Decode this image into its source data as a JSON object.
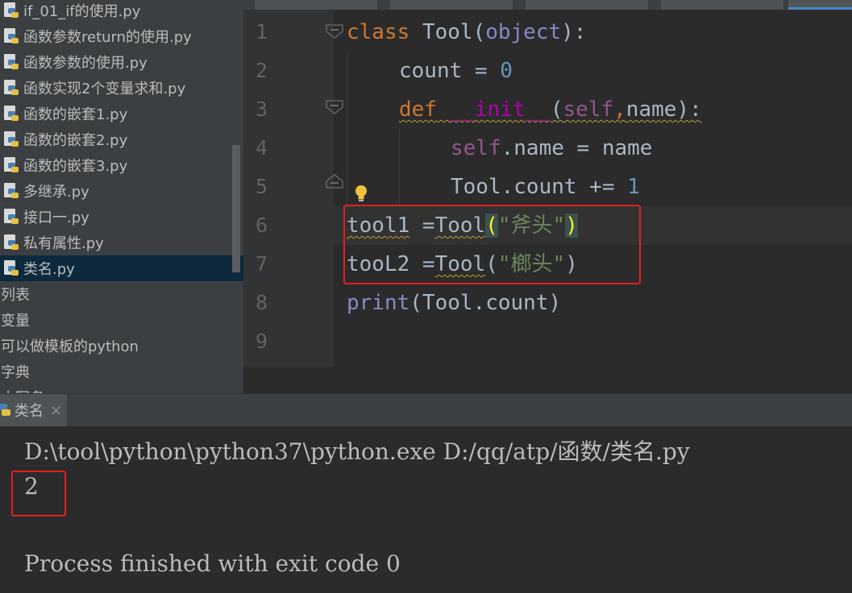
{
  "project_tree": {
    "items": [
      {
        "label": "if_01_if的使用.py",
        "type": "python-file"
      },
      {
        "label": "函数参数return的使用.py",
        "type": "python-file"
      },
      {
        "label": "函数参数的使用.py",
        "type": "python-file"
      },
      {
        "label": "函数实现2个变量求和.py",
        "type": "python-file"
      },
      {
        "label": "函数的嵌套1.py",
        "type": "python-file"
      },
      {
        "label": "函数的嵌套2.py",
        "type": "python-file"
      },
      {
        "label": "函数的嵌套3.py",
        "type": "python-file"
      },
      {
        "label": "多继承.py",
        "type": "python-file"
      },
      {
        "label": "接口一.py",
        "type": "python-file"
      },
      {
        "label": "私有属性.py",
        "type": "python-file"
      },
      {
        "label": "类名.py",
        "type": "python-file",
        "selected": true
      },
      {
        "label": "列表",
        "type": "folder"
      },
      {
        "label": "变量",
        "type": "folder"
      },
      {
        "label": "可以做模板的python",
        "type": "folder"
      },
      {
        "label": "字典",
        "type": "folder"
      },
      {
        "label": "小写名",
        "type": "folder"
      }
    ]
  },
  "editor": {
    "line_numbers": [
      "1",
      "2",
      "3",
      "4",
      "5",
      "6",
      "7",
      "8",
      "9"
    ],
    "code": {
      "l1": {
        "kw": "class",
        "name": "Tool",
        "p1": "(",
        "base": "object",
        "p2": "):"
      },
      "l2": {
        "var": "count",
        "op": " = ",
        "num": "0"
      },
      "l3": {
        "kw": "def",
        "sp": " ",
        "name": "__init__",
        "p1": "(",
        "self": "self",
        "comma": ",",
        "arg": "name",
        "p2": "):"
      },
      "l4": {
        "self": "self",
        "rest": ".name = name"
      },
      "l5": {
        "lhs": "Tool.count += ",
        "num": "1"
      },
      "l6": {
        "var": "tool1",
        "op": " =",
        "call": "Tool",
        "p1": "(",
        "str": "\"斧头\"",
        "p2": ")"
      },
      "l7": {
        "var": "tooL2",
        "op": " =",
        "call": "Tool",
        "p1": "(",
        "str": "\"榔头\"",
        "p2": ")"
      },
      "l8": {
        "fn": "print",
        "arg": "(Tool.count)"
      }
    },
    "colors": {
      "keyword": "#cc7832",
      "builtin": "#8888c6",
      "number": "#6897bb",
      "self": "#94558d",
      "string": "#6a8759",
      "magic": "#b200b2",
      "highlight_box": "#e0201e"
    }
  },
  "run_panel": {
    "tab_label": "类名",
    "close_glyph": "×",
    "console_lines": [
      "D:\\tool\\python\\python37\\python.exe D:/qq/atp/函数/类名.py",
      "2",
      "",
      "Process finished with exit code 0"
    ]
  }
}
